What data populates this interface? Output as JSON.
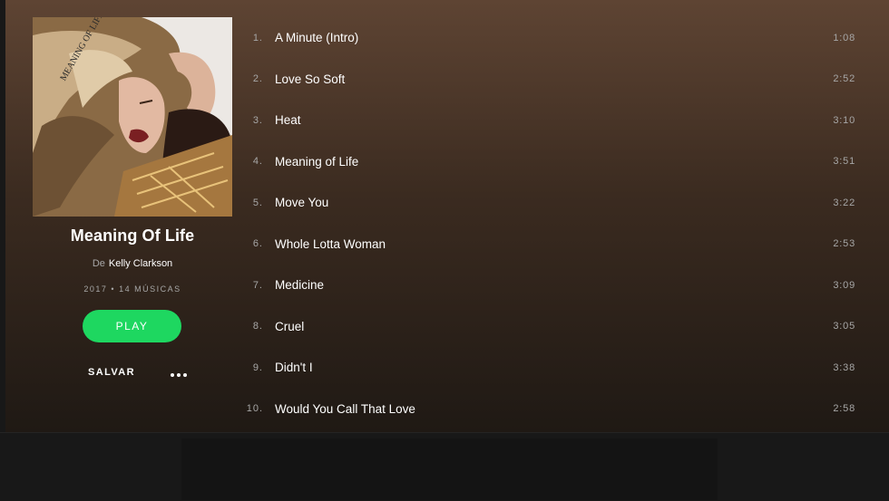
{
  "album": {
    "title": "Meaning Of Life",
    "by_prefix": "De",
    "artist": "Kelly Clarkson",
    "meta": "2017 • 14 MÚSICAS",
    "cover_text": "MEANING OF LIFE"
  },
  "actions": {
    "play_label": "PLAY",
    "save_label": "SALVAR",
    "more_icon": "more-horizontal-icon"
  },
  "tracks": [
    {
      "number": "1.",
      "title": "A Minute (Intro)",
      "duration": "1:08"
    },
    {
      "number": "2.",
      "title": "Love So Soft",
      "duration": "2:52"
    },
    {
      "number": "3.",
      "title": "Heat",
      "duration": "3:10"
    },
    {
      "number": "4.",
      "title": "Meaning of Life",
      "duration": "3:51"
    },
    {
      "number": "5.",
      "title": "Move You",
      "duration": "3:22"
    },
    {
      "number": "6.",
      "title": "Whole Lotta Woman",
      "duration": "2:53"
    },
    {
      "number": "7.",
      "title": "Medicine",
      "duration": "3:09"
    },
    {
      "number": "8.",
      "title": "Cruel",
      "duration": "3:05"
    },
    {
      "number": "9.",
      "title": "Didn't I",
      "duration": "3:38"
    },
    {
      "number": "10.",
      "title": "Would You Call That Love",
      "duration": "2:58"
    }
  ],
  "colors": {
    "accent_green": "#1ed760",
    "background_top": "#5e4433",
    "background_bottom": "#1f1914",
    "secondary_text": "#a7a7a7"
  }
}
